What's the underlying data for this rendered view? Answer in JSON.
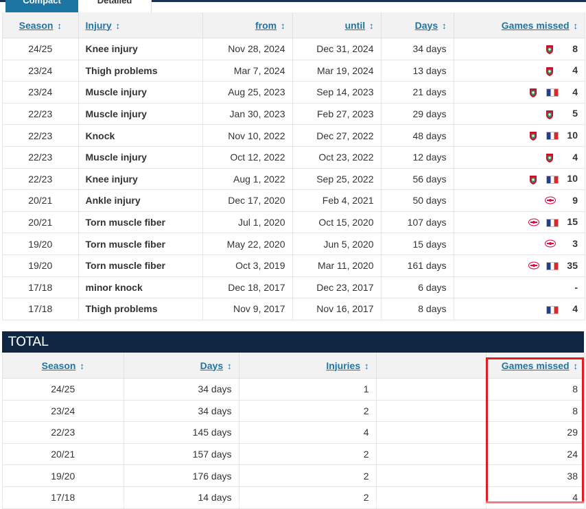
{
  "tabs": {
    "compact": "Compact",
    "detailed": "Detailed"
  },
  "injury_table": {
    "headers": {
      "season": "Season",
      "injury": "Injury",
      "from": "from",
      "until": "until",
      "days": "Days",
      "games_missed": "Games missed"
    },
    "sort_icon": "↕",
    "rows": [
      {
        "season": "24/25",
        "injury": "Knee injury",
        "from": "Nov 28, 2024",
        "until": "Dec 31, 2024",
        "days": "34 days",
        "club": "liverpool-crest-icon",
        "flag": false,
        "games": "8"
      },
      {
        "season": "23/24",
        "injury": "Thigh problems",
        "from": "Mar 7, 2024",
        "until": "Mar 19, 2024",
        "days": "13 days",
        "club": "liverpool-crest-icon",
        "flag": false,
        "games": "4"
      },
      {
        "season": "23/24",
        "injury": "Muscle injury",
        "from": "Aug 25, 2023",
        "until": "Sep 14, 2023",
        "days": "21 days",
        "club": "liverpool-crest-icon",
        "flag": true,
        "games": "4"
      },
      {
        "season": "22/23",
        "injury": "Muscle injury",
        "from": "Jan 30, 2023",
        "until": "Feb 27, 2023",
        "days": "29 days",
        "club": "liverpool-crest-icon",
        "flag": false,
        "games": "5"
      },
      {
        "season": "22/23",
        "injury": "Knock",
        "from": "Nov 10, 2022",
        "until": "Dec 27, 2022",
        "days": "48 days",
        "club": "liverpool-crest-icon",
        "flag": true,
        "games": "10"
      },
      {
        "season": "22/23",
        "injury": "Muscle injury",
        "from": "Oct 12, 2022",
        "until": "Oct 23, 2022",
        "days": "12 days",
        "club": "liverpool-crest-icon",
        "flag": false,
        "games": "4"
      },
      {
        "season": "22/23",
        "injury": "Knee injury",
        "from": "Aug 1, 2022",
        "until": "Sep 25, 2022",
        "days": "56 days",
        "club": "liverpool-crest-icon",
        "flag": true,
        "games": "10"
      },
      {
        "season": "20/21",
        "injury": "Ankle injury",
        "from": "Dec 17, 2020",
        "until": "Feb 4, 2021",
        "days": "50 days",
        "club": "leipzig-crest-icon",
        "flag": false,
        "games": "9"
      },
      {
        "season": "20/21",
        "injury": "Torn muscle fiber",
        "from": "Jul 1, 2020",
        "until": "Oct 15, 2020",
        "days": "107 days",
        "club": "leipzig-crest-icon",
        "flag": true,
        "games": "15"
      },
      {
        "season": "19/20",
        "injury": "Torn muscle fiber",
        "from": "May 22, 2020",
        "until": "Jun 5, 2020",
        "days": "15 days",
        "club": "leipzig-crest-icon",
        "flag": false,
        "games": "3"
      },
      {
        "season": "19/20",
        "injury": "Torn muscle fiber",
        "from": "Oct 3, 2019",
        "until": "Mar 11, 2020",
        "days": "161 days",
        "club": "leipzig-crest-icon",
        "flag": true,
        "games": "35"
      },
      {
        "season": "17/18",
        "injury": "minor knock",
        "from": "Dec 18, 2017",
        "until": "Dec 23, 2017",
        "days": "6 days",
        "club": "",
        "flag": false,
        "games": "-"
      },
      {
        "season": "17/18",
        "injury": "Thigh problems",
        "from": "Nov 9, 2017",
        "until": "Nov 16, 2017",
        "days": "8 days",
        "club": "",
        "flag": true,
        "games": "4"
      }
    ]
  },
  "total": {
    "title": "TOTAL",
    "headers": {
      "season": "Season",
      "days": "Days",
      "injuries": "Injuries",
      "games_missed": "Games missed"
    },
    "rows": [
      {
        "season": "24/25",
        "days": "34 days",
        "injuries": "1",
        "games": "8"
      },
      {
        "season": "23/24",
        "days": "34 days",
        "injuries": "2",
        "games": "8"
      },
      {
        "season": "22/23",
        "days": "145 days",
        "injuries": "4",
        "games": "29"
      },
      {
        "season": "20/21",
        "days": "157 days",
        "injuries": "2",
        "games": "24"
      },
      {
        "season": "19/20",
        "days": "176 days",
        "injuries": "2",
        "games": "38"
      },
      {
        "season": "17/18",
        "days": "14 days",
        "injuries": "2",
        "games": "4"
      }
    ]
  },
  "colors": {
    "link": "#1d75a3",
    "header_bg": "#0f2542",
    "highlight": "#e01b24",
    "liverpool_red": "#c8102e",
    "leipzig_red": "#dd0741"
  }
}
